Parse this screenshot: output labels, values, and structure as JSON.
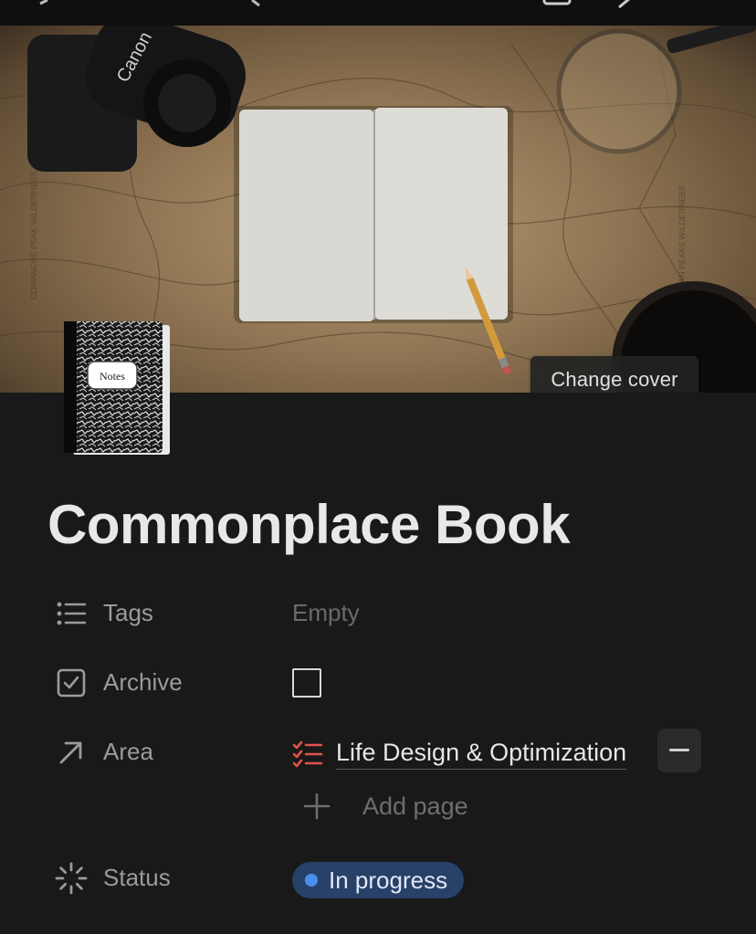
{
  "page": {
    "title": "Commonplace Book",
    "cover": {
      "change_cover_label": "Change cover",
      "image_description": "Overhead photo: open blank notebook with pencil on a topographic map, camera, magnifying glass and coffee cup"
    },
    "icon": "notebook-emoji",
    "icon_label": "Notes",
    "camera_brand": "Canon"
  },
  "properties": {
    "tags": {
      "label": "Tags",
      "value": "Empty",
      "icon": "list-icon"
    },
    "archive": {
      "label": "Archive",
      "checked": false,
      "icon": "checkbox-icon"
    },
    "area": {
      "label": "Area",
      "icon": "arrow-up-right-icon",
      "link": "Life Design & Optimization",
      "link_icon": "checklist-icon",
      "add_page_label": "Add page"
    },
    "status": {
      "label": "Status",
      "value": "In progress",
      "icon": "status-spinner-icon",
      "color": "#4a8ff0"
    }
  },
  "colors": {
    "background": "#191919",
    "status_pill": "#284168",
    "checklist_icon": "#e0524a"
  }
}
